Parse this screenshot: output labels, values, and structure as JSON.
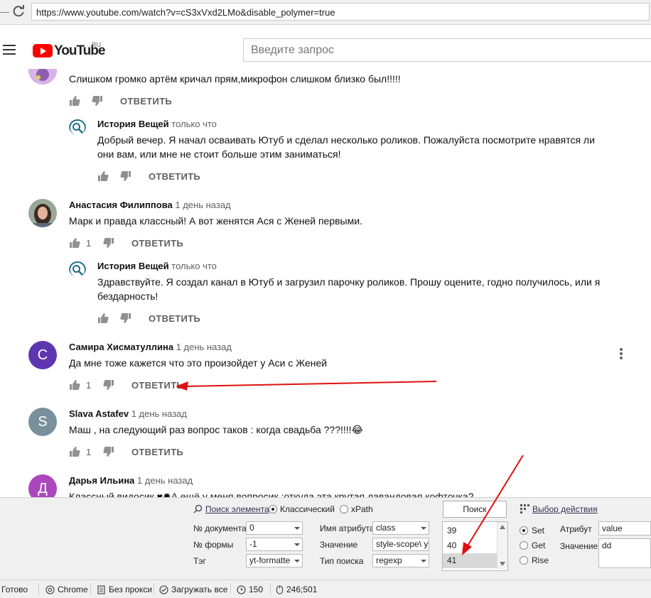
{
  "browser": {
    "url": "https://www.youtube.com/watch?v=cS3xVxd2LMo&disable_polymer=true"
  },
  "youtube": {
    "logo_text": "YouTube",
    "logo_region": "RU",
    "search_placeholder": "Введите запрос"
  },
  "comments": [
    {
      "author": "",
      "time": "",
      "text": "Слишком громко артём кричал прям,микрофон слишком близко был!!!!!",
      "likes": "",
      "reply_label": "ОТВЕТИТЬ",
      "replies": [
        {
          "author": "История Вещей",
          "time": "только что",
          "text_line1": "Добрый вечер. Я начал осваивать Ютуб и сделал несколько роликов. Пожалуйста посмотрите нравятся ли",
          "text_line2": "они вам, или мне не стоит больше этим заниматься!",
          "reply_label": "ОТВЕТИТЬ"
        }
      ]
    },
    {
      "author": "Анастасия Филиппова",
      "time": "1 день назад",
      "text": "Марк и правда классный! А вот женятся Ася с Женей первыми.",
      "likes": "1",
      "reply_label": "ОТВЕТИТЬ",
      "replies": [
        {
          "author": "История Вещей",
          "time": "только что",
          "text_line1": "Здравствуйте. Я создал канал в Ютуб и загрузил парочку роликов. Прошу оцените, годно получилось, или я",
          "text_line2": "бездарность!",
          "reply_label": "ОТВЕТИТЬ"
        }
      ]
    },
    {
      "author": "Самира Хисматуллина",
      "time": "1 день назад",
      "initial": "С",
      "avatar_color": "#5e35b1",
      "text": "Да мне тоже кажется что это произойдет у Аси с Женей",
      "likes": "1",
      "reply_label": "ОТВЕТИТЬ"
    },
    {
      "author": "Slava Astafev",
      "time": "1 день назад",
      "initial": "S",
      "avatar_color": "#78909c",
      "text": "Маш , на следующий раз вопрос таков : когда свадьба ???!!!!😂",
      "likes": "1",
      "reply_label": "ОТВЕТИТЬ"
    },
    {
      "author": "Дарья Ильина",
      "time": "1 день назад",
      "initial": "Д",
      "avatar_color": "#ab47bc",
      "text": "Классный видосик ♥✹А ещё у меня вопросик :откуда эта крутая лавандовая кофточка?"
    }
  ],
  "panel": {
    "search_element": "Поиск элемента",
    "mode_classic": "Классический",
    "mode_xpath": "xPath",
    "search_button": "Поиск",
    "action_select": "Выбор действия",
    "doc_label": "№ документа",
    "doc_value": "0",
    "form_label": "№ формы",
    "form_value": "-1",
    "tag_label": "Тэг",
    "tag_value": "yt-formatte",
    "attr_name_label": "Имя атрибута",
    "attr_name_value": "class",
    "value_label": "Значение",
    "value_value": "style-scope\\ yt",
    "search_type_label": "Тип поиска",
    "search_type_value": "regexp",
    "results": [
      "39",
      "40",
      "41"
    ],
    "op_set": "Set",
    "op_get": "Get",
    "op_rise": "Rise",
    "attribute_label": "Атрибут",
    "attribute_value": "value",
    "value2_label": "Значение",
    "value2_value": "dd"
  },
  "status": {
    "ready": "Готово",
    "browser": "Chrome",
    "proxy": "Без прокси",
    "load_all": "Загружать все",
    "timer": "150",
    "coords": "246;501"
  },
  "colors": {
    "yt_red": "#ff0000",
    "annotation_arrow": "#e01010"
  }
}
